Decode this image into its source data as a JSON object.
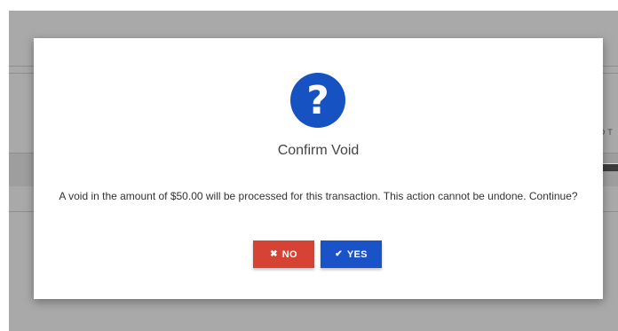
{
  "background": {
    "overlay_color": "#a9a9a9",
    "edge_label": "RD T"
  },
  "dialog": {
    "icon": "question-circle-icon",
    "icon_color": "#1652c2",
    "icon_glyph": "?",
    "title": "Confirm Void",
    "message": "A void in the amount of $50.00 will be processed for this transaction. This action cannot be undone. Continue?",
    "buttons": {
      "no": {
        "label": "NO",
        "icon": "x-icon",
        "glyph": "✖",
        "color": "#d64234"
      },
      "yes": {
        "label": "YES",
        "icon": "checkmark-icon",
        "glyph": "✔",
        "color": "#1a53c7"
      }
    }
  }
}
